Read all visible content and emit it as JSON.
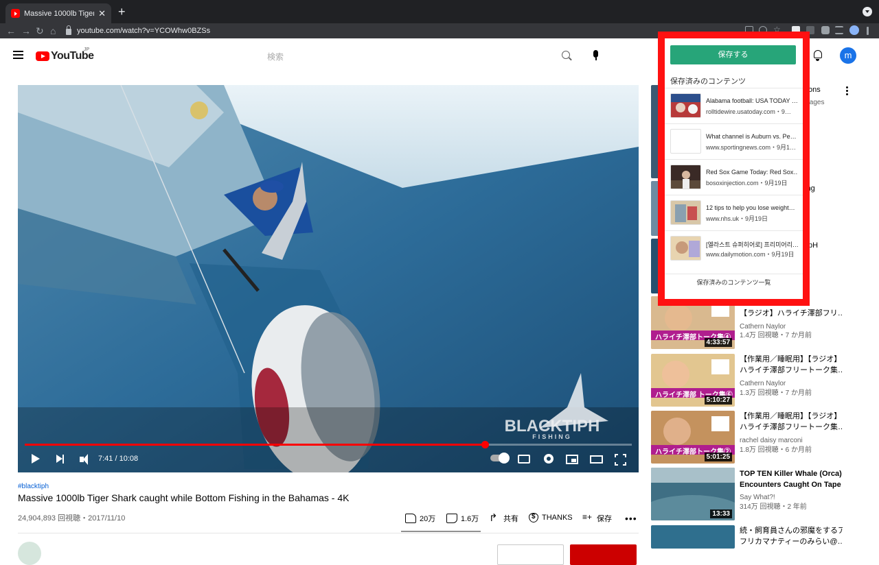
{
  "browser": {
    "tab_title": "Massive 1000lb Tiger Shark ca",
    "tab_close": "✕",
    "new_tab": "+",
    "url": "youtube.com/watch?v=YCOWhw0BZSs",
    "icons": [
      "back-icon",
      "forward-icon",
      "reload-icon",
      "home-icon",
      "lock-icon"
    ]
  },
  "header": {
    "logo_text": "YouTube",
    "region": "JP",
    "search_placeholder": "検索",
    "avatar_letter": "m"
  },
  "player": {
    "time": "7:41 / 10:08",
    "progress_fraction": 0.758,
    "watermark_line1": "BLACKTIPH",
    "watermark_line2": "FISHING"
  },
  "video": {
    "hashtag": "#blacktiph",
    "title": "Massive 1000lb Tiger Shark caught while Bottom Fishing in the Bahamas - 4K",
    "view_info": "24,904,893 回視聴・2017/11/10",
    "likes": "20万",
    "dislikes": "1.6万",
    "share_label": "共有",
    "thanks_label": "THANKS",
    "save_label": "保存",
    "more": "•••"
  },
  "recommendations": {
    "partial": {
      "title_1_tail": "lloons",
      "meta_1_tail": "all ages",
      "title_2_tail": "hing",
      "title_3_tail": "ktipH"
    },
    "items": [
      {
        "title_line1": "【作業用／睡眠用】",
        "title_line2": "【ラジオ】ハライチ澤部フリ…",
        "channel": "Cathern Naylor",
        "stats": "1.4万 回視聴・7 か月前",
        "duration": "4:33:57",
        "thumb_caption": "ハライチ澤部トーク集④"
      },
      {
        "title_line1": "【作業用／睡眠用】【ラジオ】",
        "title_line2": "ハライチ澤部フリートーク集…",
        "channel": "Cathern Naylor",
        "stats": "1.3万 回視聴・7 か月前",
        "duration": "5:10:27",
        "thumb_caption": "ハライチ澤部 トーク集⑥"
      },
      {
        "title_line1": "【作業用／睡眠用】【ラジオ】",
        "title_line2": "ハライチ澤部フリートーク集…",
        "channel": "rachel daisy marconi",
        "stats": "1.8万 回視聴・6 か月前",
        "duration": "5:01:25",
        "thumb_caption": "ハライチ澤部トーク集②"
      },
      {
        "title_line1": "TOP TEN Killer Whale (Orca)",
        "title_line2": "Encounters Caught On Tape",
        "channel": "Say What?!",
        "stats": "314万 回視聴・2 年前",
        "duration": "13:33",
        "thumb_caption": ""
      },
      {
        "title_line1": "続・飼育員さんの邪魔をするア",
        "title_line2": "フリカマナティーのみらい@…",
        "channel": "",
        "stats": "",
        "duration": "",
        "thumb_caption": ""
      }
    ]
  },
  "popup": {
    "save_button": "保存する",
    "heading": "保存済みのコンテンツ",
    "items": [
      {
        "title": "Alabama football: USA TODAY …",
        "meta": "rolltidewire.usatoday.com・9…"
      },
      {
        "title": "What channel is Auburn vs. Pe…",
        "meta": "www.sportingnews.com・9月1…"
      },
      {
        "title": "Red Sox Game Today: Red Sox…",
        "meta": "bosoxinjection.com・9月19日"
      },
      {
        "title": "12 tips to help you lose weight…",
        "meta": "www.nhs.uk・9月19日"
      },
      {
        "title": "[엘라스트 슈퍼히어로] 프리미어리…",
        "meta": "www.dailymotion.com・9月19日"
      }
    ],
    "footer_link": "保存済みのコンテンツ一覧",
    "border_color": "#ff1111",
    "button_color": "#27a579"
  }
}
